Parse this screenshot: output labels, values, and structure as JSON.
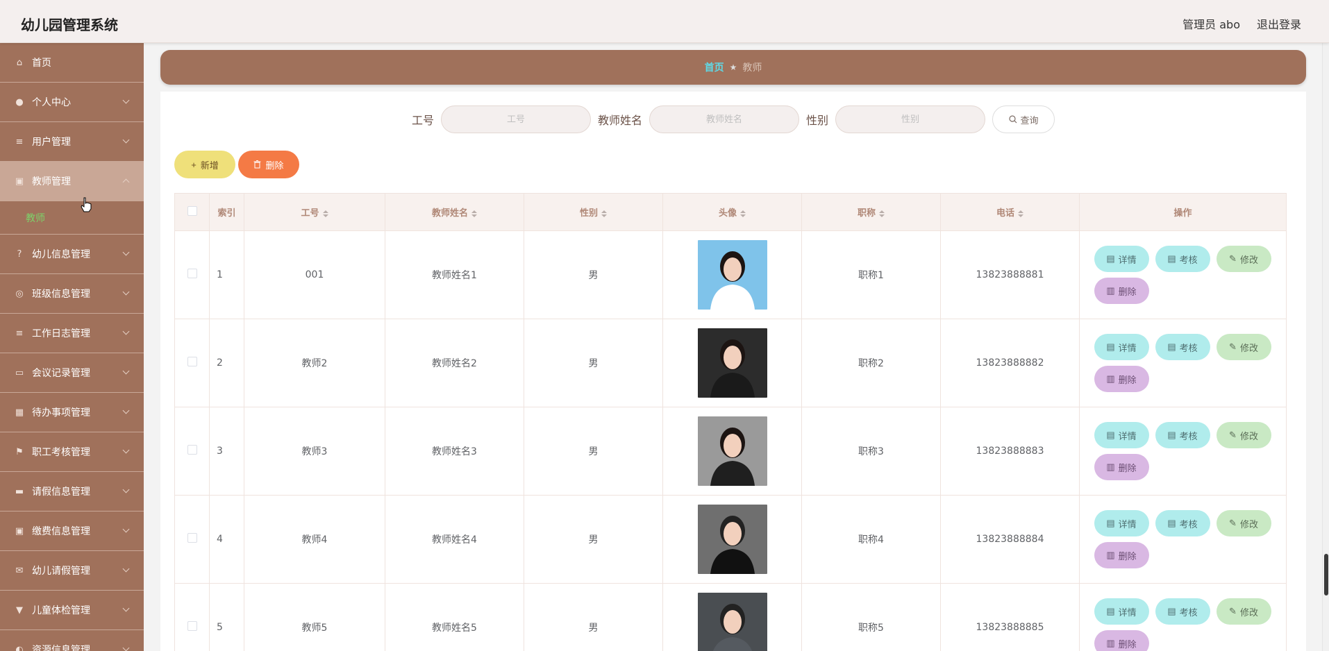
{
  "header": {
    "app_title": "幼儿园管理系统",
    "user_label": "管理员 abo",
    "logout_label": "退出登录"
  },
  "sidebar": {
    "items": [
      {
        "label": "首页",
        "icon": "home-icon",
        "glyph": "⌂"
      },
      {
        "label": "个人中心",
        "icon": "user-icon",
        "glyph": "●"
      },
      {
        "label": "用户管理",
        "icon": "menu-icon",
        "glyph": "≡"
      },
      {
        "label": "教师管理",
        "icon": "clipboard-icon",
        "glyph": "▣"
      },
      {
        "label": "幼儿信息管理",
        "icon": "help-icon",
        "glyph": "?"
      },
      {
        "label": "班级信息管理",
        "icon": "compass-icon",
        "glyph": "◎"
      },
      {
        "label": "工作日志管理",
        "icon": "list-icon",
        "glyph": "≡"
      },
      {
        "label": "会议记录管理",
        "icon": "monitor-icon",
        "glyph": "▭"
      },
      {
        "label": "待办事项管理",
        "icon": "grid-icon",
        "glyph": "▦"
      },
      {
        "label": "职工考核管理",
        "icon": "flag-icon",
        "glyph": "⚑"
      },
      {
        "label": "请假信息管理",
        "icon": "ticket-icon",
        "glyph": "▬"
      },
      {
        "label": "缴费信息管理",
        "icon": "clipboard-icon",
        "glyph": "▣"
      },
      {
        "label": "幼儿请假管理",
        "icon": "mail-icon",
        "glyph": "✉"
      },
      {
        "label": "儿童体检管理",
        "icon": "stamp-icon",
        "glyph": "▼"
      },
      {
        "label": "资源信息管理",
        "icon": "resource-icon",
        "glyph": "◐"
      }
    ],
    "submenu": {
      "label": "教师"
    }
  },
  "breadcrumb": {
    "home": "首页",
    "separator": "★",
    "current": "教师"
  },
  "search": {
    "id_label": "工号",
    "id_placeholder": "工号",
    "name_label": "教师姓名",
    "name_placeholder": "教师姓名",
    "gender_label": "性别",
    "gender_placeholder": "性别",
    "button_label": "查询"
  },
  "actions": {
    "add_label": "新增",
    "delete_label": "删除"
  },
  "table": {
    "headers": {
      "index": "索引",
      "id": "工号",
      "name": "教师姓名",
      "gender": "性别",
      "avatar": "头像",
      "title": "职称",
      "phone": "电话",
      "ops": "操作"
    },
    "op_labels": {
      "detail": "详情",
      "check": "考核",
      "edit": "修改",
      "delete": "删除"
    },
    "rows": [
      {
        "index": "1",
        "id": "001",
        "name": "教师姓名1",
        "gender": "男",
        "title": "职称1",
        "phone": "13823888881"
      },
      {
        "index": "2",
        "id": "教师2",
        "name": "教师姓名2",
        "gender": "男",
        "title": "职称2",
        "phone": "13823888882"
      },
      {
        "index": "3",
        "id": "教师3",
        "name": "教师姓名3",
        "gender": "男",
        "title": "职称3",
        "phone": "13823888883"
      },
      {
        "index": "4",
        "id": "教师4",
        "name": "教师姓名4",
        "gender": "男",
        "title": "职称4",
        "phone": "13823888884"
      },
      {
        "index": "5",
        "id": "教师5",
        "name": "教师姓名5",
        "gender": "男",
        "title": "职称5",
        "phone": "13823888885"
      }
    ]
  },
  "colors": {
    "brand": "#a0715b",
    "breadcrumb_home": "#5fd9e6",
    "submenu_active": "#7dd36a",
    "add_button": "#efe07a",
    "delete_button": "#f47a45"
  }
}
